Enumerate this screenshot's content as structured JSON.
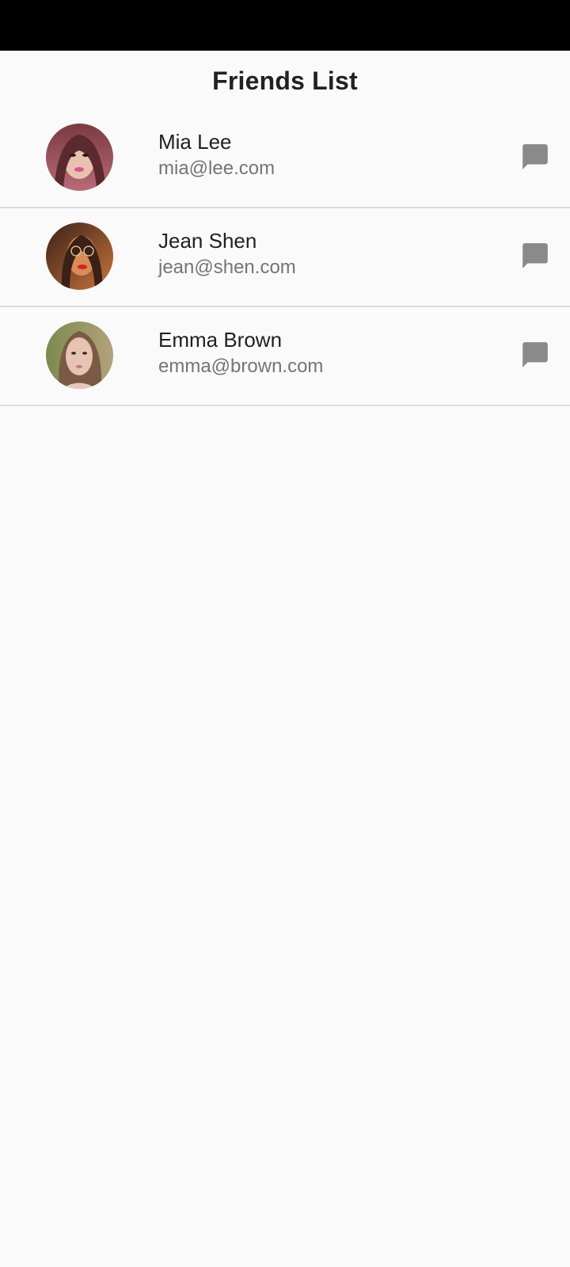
{
  "header": {
    "title": "Friends List"
  },
  "friends": [
    {
      "name": "Mia Lee",
      "email": "mia@lee.com",
      "avatar_icon": "avatar-photo",
      "action_icon": "message-icon"
    },
    {
      "name": "Jean Shen",
      "email": "jean@shen.com",
      "avatar_icon": "avatar-photo",
      "action_icon": "message-icon"
    },
    {
      "name": "Emma Brown",
      "email": "emma@brown.com",
      "avatar_icon": "avatar-photo",
      "action_icon": "message-icon"
    }
  ],
  "colors": {
    "status_bar": "#000000",
    "background": "#fafafa",
    "divider": "#dcdcdc",
    "primary_text": "#212121",
    "secondary_text": "#757575",
    "icon": "#8a8a8a"
  }
}
